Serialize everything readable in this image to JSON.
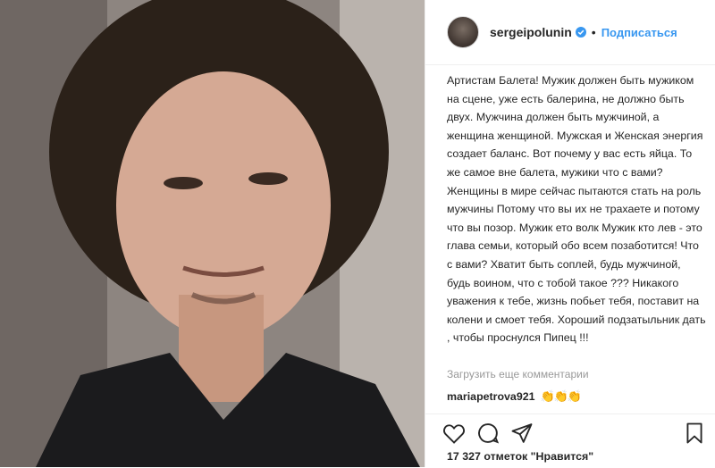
{
  "header": {
    "username": "sergeipolunin",
    "separator": "•",
    "follow_label": "Подписаться"
  },
  "caption_text": "Артистам Балета! Мужик должен быть мужиком на сцене, уже есть балерина, не должно быть двух. Мужчина должен быть мужчиной, а женщина женщиной. Мужская и Женская энергия создает баланс. Вот почему у вас есть яйца. То же самое вне балета, мужики что с вами? Женщины в мире сейчас пытаются стать на роль мужчины Потому что вы их не трахаете и потому что вы позор. Мужик ето волк Мужик кто лев - это глава семьи, который обо всем позаботится! Что с вами? Хватит быть соплей, будь мужчиной, будь воином, что с тобой такое ??? Никакого уважения к тебе, жизнь побьет тебя, поставит на колени и смоет тебя. Хороший подзатыльник дать , чтобы проснулся Пипец !!!",
  "load_more_label": "Загрузить еще комментарии",
  "comment": {
    "username": "mariapetrova921",
    "text": "👏👏👏"
  },
  "likes_text": "17 327 отметок \"Нравится\"",
  "icons": [
    "verified-icon",
    "heart-icon",
    "comment-icon",
    "share-icon",
    "bookmark-icon"
  ],
  "colors": {
    "link": "#3897f0",
    "text": "#262626",
    "muted": "#999999",
    "border": "#efefef"
  }
}
